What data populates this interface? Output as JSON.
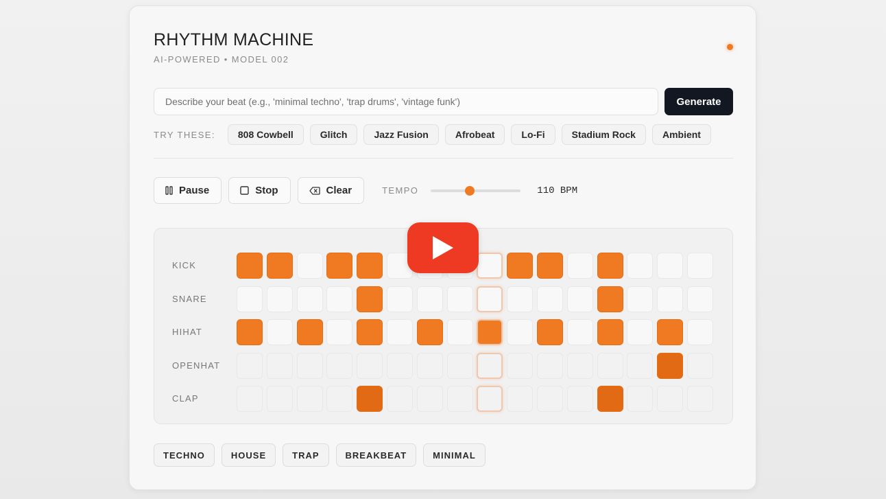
{
  "app": {
    "title": "RHYTHM MACHINE",
    "subtitle": "AI-POWERED • MODEL 002",
    "status_color": "#f07a22"
  },
  "prompt": {
    "placeholder": "Describe your beat (e.g., 'minimal techno', 'trap drums', 'vintage funk')",
    "value": "",
    "generate_label": "Generate"
  },
  "suggestions": {
    "label": "TRY THESE:",
    "items": [
      "808 Cowbell",
      "Glitch",
      "Jazz Fusion",
      "Afrobeat",
      "Lo-Fi",
      "Stadium Rock",
      "Ambient"
    ]
  },
  "transport": {
    "pause_label": "Pause",
    "stop_label": "Stop",
    "clear_label": "Clear",
    "tempo_label": "TEMPO",
    "bpm_text": "110 BPM",
    "tempo_fraction": 0.43
  },
  "sequencer": {
    "steps": 16,
    "current_step": 8,
    "accent_color": "#f07a22",
    "tracks": [
      {
        "name": "KICK",
        "pattern": [
          1,
          1,
          0,
          1,
          1,
          0,
          0,
          0,
          0,
          1,
          1,
          0,
          1,
          0,
          0,
          0
        ]
      },
      {
        "name": "SNARE",
        "pattern": [
          0,
          0,
          0,
          0,
          1,
          0,
          0,
          0,
          0,
          0,
          0,
          0,
          1,
          0,
          0,
          0
        ]
      },
      {
        "name": "HIHAT",
        "pattern": [
          1,
          0,
          1,
          0,
          1,
          0,
          1,
          0,
          1,
          0,
          1,
          0,
          1,
          0,
          1,
          0
        ]
      },
      {
        "name": "OPENHAT",
        "pattern": [
          0,
          0,
          0,
          0,
          0,
          0,
          0,
          0,
          0,
          0,
          0,
          0,
          0,
          0,
          1,
          0
        ]
      },
      {
        "name": "CLAP",
        "pattern": [
          0,
          0,
          0,
          0,
          1,
          0,
          0,
          0,
          0,
          0,
          0,
          0,
          1,
          0,
          0,
          0
        ]
      }
    ]
  },
  "presets": [
    "TECHNO",
    "HOUSE",
    "TRAP",
    "BREAKBEAT",
    "MINIMAL"
  ],
  "overlay": {
    "icon": "youtube-play-icon",
    "color": "#ee3a22"
  }
}
